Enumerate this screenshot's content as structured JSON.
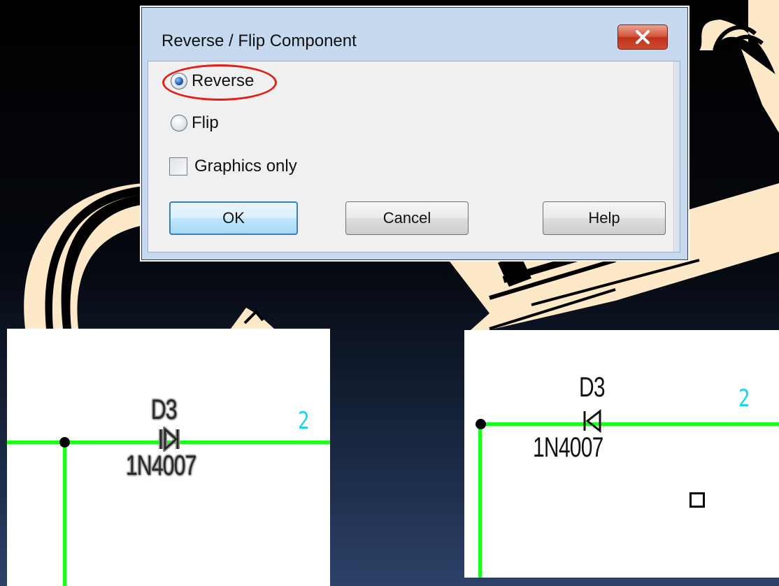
{
  "dialog": {
    "title": "Reverse / Flip Component",
    "close_icon": "close-x-icon",
    "options": {
      "reverse_label": "Reverse",
      "reverse_selected": true,
      "flip_label": "Flip",
      "flip_selected": false
    },
    "graphics_only_label": "Graphics only",
    "graphics_only_checked": false,
    "buttons": {
      "ok": "OK",
      "cancel": "Cancel",
      "help": "Help"
    }
  },
  "schematic_before": {
    "ref": "D3",
    "part_value": "1N4007",
    "pin_number": "2"
  },
  "schematic_after": {
    "ref": "D3",
    "part_value": "1N4007",
    "pin_number": "2"
  },
  "colors": {
    "wire": "#1aff1a",
    "pin_number": "#19d3f0",
    "highlight": "#e0201b",
    "arrow": "#fde8c8"
  }
}
